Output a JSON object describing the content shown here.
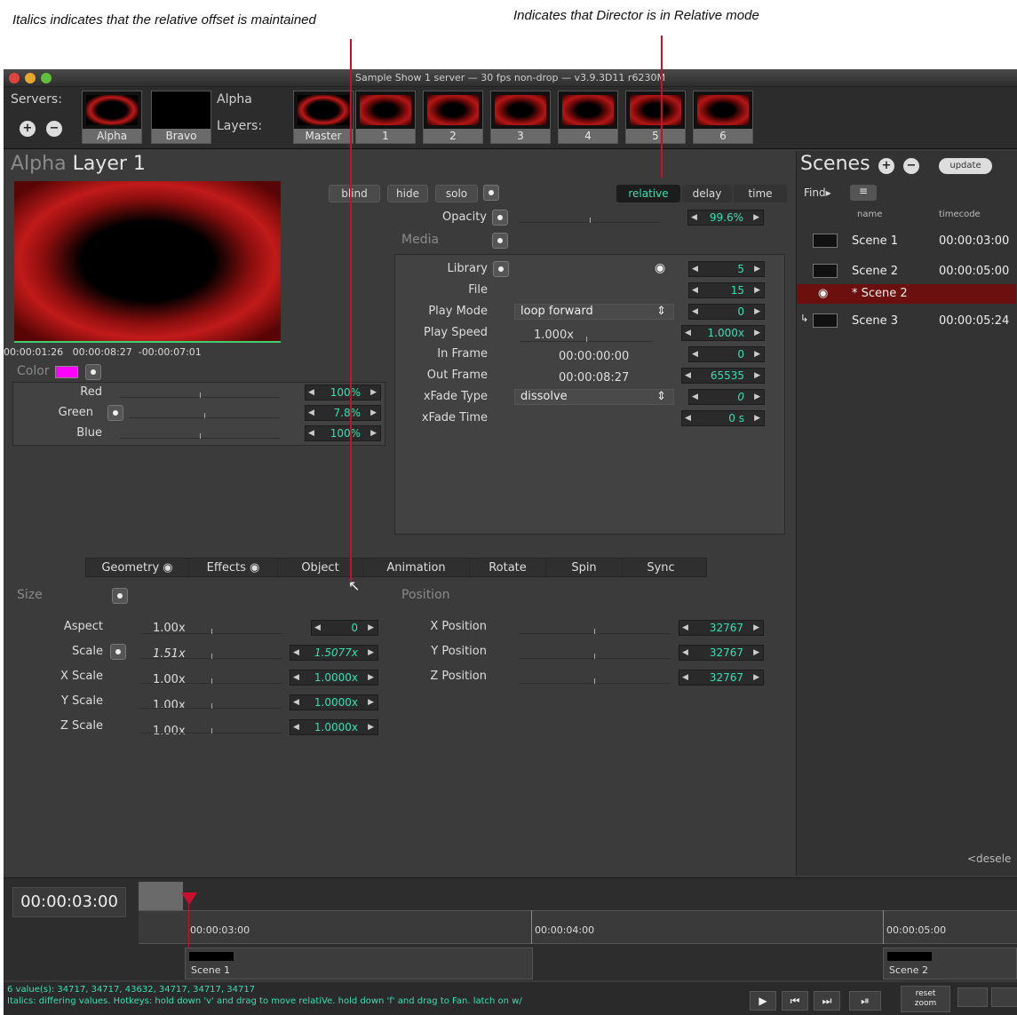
{
  "annotations": {
    "left": "Italics indicates that the relative offset is maintained",
    "right": "Indicates that Director is in Relative mode"
  },
  "window": {
    "title": "Sample Show 1 server  —  30 fps non-drop  —  v3.9.3D11 r6230M"
  },
  "servers": {
    "label": "Servers:",
    "items": [
      "Alpha",
      "Bravo"
    ],
    "alpha_label": "Alpha",
    "layers_label": "Layers:",
    "master": "Master",
    "layers": [
      "1",
      "2",
      "3",
      "4",
      "5",
      "6"
    ]
  },
  "layer": {
    "server": "Alpha",
    "name": "Layer 1",
    "tc_current": "00:00:01:26",
    "tc_end": "00:00:08:27",
    "tc_remain": "-00:00:07:01",
    "buttons": {
      "blind": "blind",
      "hide": "hide",
      "solo": "solo"
    },
    "modes": [
      "relative",
      "delay",
      "time"
    ],
    "opacity_label": "Opacity",
    "opacity": "99.6%",
    "media_label": "Media",
    "library_label": "Library",
    "library": "5",
    "file_label": "File",
    "file": "15",
    "playmode_label": "Play Mode",
    "playmode": "loop forward",
    "playmode_num": "0",
    "playspeed_label": "Play Speed",
    "playspeed": "1.000x",
    "playspeed_num": "1.000x",
    "inframe_label": "In Frame",
    "inframe": "00:00:00:00",
    "inframe_num": "0",
    "outframe_label": "Out Frame",
    "outframe": "00:00:08:27",
    "outframe_num": "65535",
    "xfade_label": "xFade Type",
    "xfade": "dissolve",
    "xfade_num": "0",
    "xfadetime_label": "xFade Time",
    "xfadetime_num": "0 s",
    "color_label": "Color",
    "red_label": "Red",
    "red": "100%",
    "green_label": "Green",
    "green": "7.8%",
    "blue_label": "Blue",
    "blue": "100%",
    "color_swatch": "#ff00ff"
  },
  "tabs": [
    "Geometry",
    "Effects",
    "Object",
    "Animation",
    "Rotate",
    "Spin",
    "Sync"
  ],
  "geometry": {
    "size_label": "Size",
    "position_label": "Position",
    "rows": [
      {
        "label": "Aspect",
        "val": "1.00x",
        "num": "0"
      },
      {
        "label": "Scale",
        "val": "1.51x",
        "num": "1.5077x"
      },
      {
        "label": "X Scale",
        "val": "1.00x",
        "num": "1.0000x"
      },
      {
        "label": "Y Scale",
        "val": "1.00x",
        "num": "1.0000x"
      },
      {
        "label": "Z Scale",
        "val": "1.00x",
        "num": "1.0000x"
      }
    ],
    "positions": [
      {
        "label": "X Position",
        "num": "32767"
      },
      {
        "label": "Y Position",
        "num": "32767"
      },
      {
        "label": "Z Position",
        "num": "32767"
      }
    ]
  },
  "scenes": {
    "title": "Scenes",
    "update": "update",
    "find": "Find▸",
    "col_name": "name",
    "col_tc": "timecode",
    "rows": [
      {
        "name": "Scene 1",
        "tc": "00:00:03:00"
      },
      {
        "name": "Scene 2",
        "tc": "00:00:05:00"
      },
      {
        "name": "* Scene 2",
        "tc": ""
      },
      {
        "name": "Scene 3",
        "tc": "00:00:05:24"
      }
    ],
    "deselect": "<desele"
  },
  "timeline": {
    "current": "00:00:03:00",
    "marks": [
      "00:00:03:00",
      "00:00:04:00",
      "00:00:05:00"
    ],
    "clips": [
      "Scene 1",
      "Scene 2"
    ]
  },
  "status": {
    "line1": "6 value(s): 34717, 34717, 43632, 34717, 34717, 34717",
    "line2": "Italics: differing values.  Hotkeys: hold down 'v' and drag to move relatiVe.  hold down 'f' and drag to Fan.  latch on w/",
    "reset": "reset",
    "zoom": "zoom"
  },
  "colors": {
    "accent": "#35e0b0",
    "selected_row": "#6b0f0f",
    "annotation_line": "#c8102e"
  }
}
